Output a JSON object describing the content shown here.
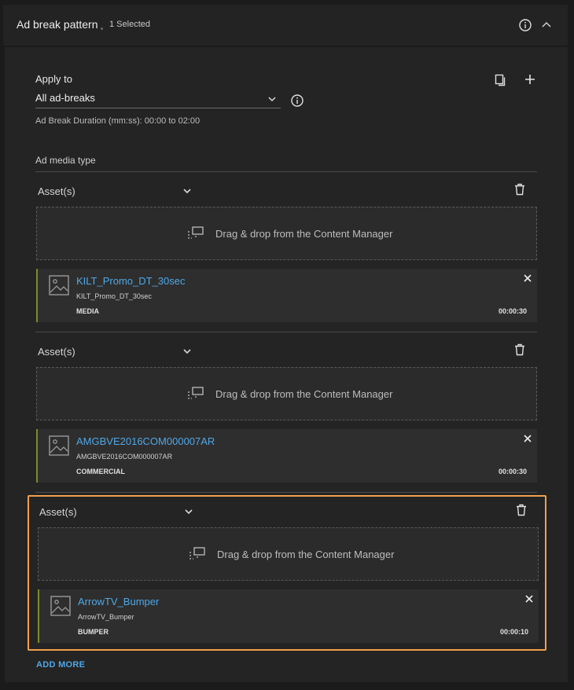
{
  "header": {
    "title": "Ad break pattern",
    "selected": "1 Selected"
  },
  "apply": {
    "label": "Apply to",
    "value": "All ad-breaks",
    "duration_note": "Ad Break Duration (mm:ss): 00:00 to 02:00"
  },
  "media_type": {
    "label": "Ad media type"
  },
  "groups": [
    {
      "asset_label": "Asset(s)",
      "drop_text": "Drag & drop from the Content Manager",
      "item": {
        "name": "KILT_Promo_DT_30sec",
        "sub": "KILT_Promo_DT_30sec",
        "type": "MEDIA",
        "duration": "00:00:30"
      }
    },
    {
      "asset_label": "Asset(s)",
      "drop_text": "Drag & drop from the Content Manager",
      "item": {
        "name": "AMGBVE2016COM000007AR",
        "sub": "AMGBVE2016COM000007AR",
        "type": "COMMERCIAL",
        "duration": "00:00:30"
      }
    },
    {
      "asset_label": "Asset(s)",
      "drop_text": "Drag & drop from the Content Manager",
      "item": {
        "name": "ArrowTV_Bumper",
        "sub": "ArrowTV_Bumper",
        "type": "BUMPER",
        "duration": "00:00:10"
      }
    }
  ],
  "add_more": "ADD MORE",
  "colors": {
    "accent_link": "#4fa8e8",
    "selected_outline": "#f0a04b",
    "card_stripe": "#7d8a2e"
  },
  "icons": [
    "info-icon",
    "chevron-up-icon",
    "copy-icon",
    "plus-icon",
    "chevron-down-icon",
    "trash-icon",
    "drag-drop-icon",
    "image-icon",
    "close-icon"
  ]
}
